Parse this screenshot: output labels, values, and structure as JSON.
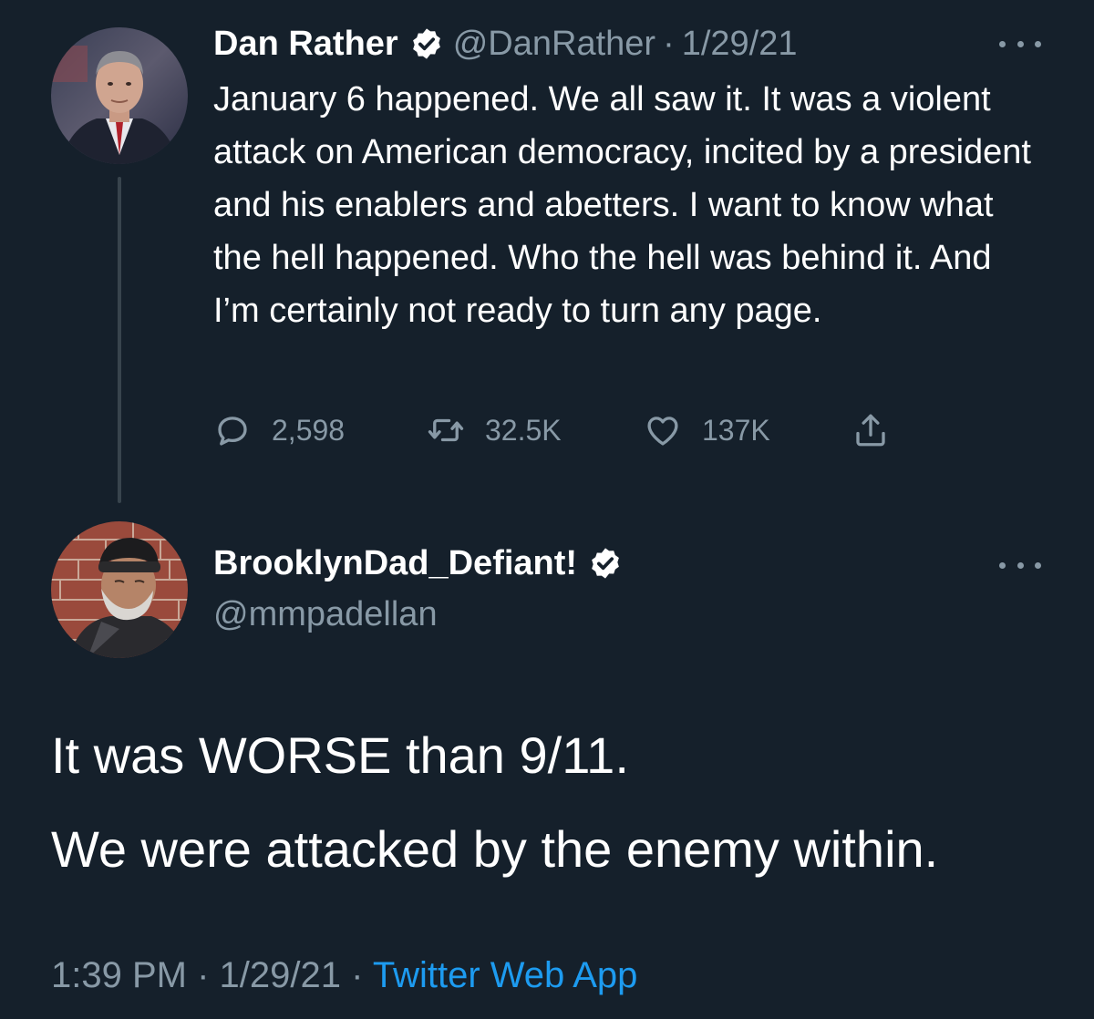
{
  "original_tweet": {
    "author_name": "Dan Rather",
    "handle": "@DanRather",
    "separator": "·",
    "date": "1/29/21",
    "text": "January 6 happened. We all saw it. It was a violent attack on American democracy, incited by a president and his enablers and abetters. I want to know what the hell happened. Who the hell was behind it. And I’m certainly not ready to turn any page.",
    "stats": {
      "replies": "2,598",
      "retweets": "32.5K",
      "likes": "137K"
    }
  },
  "reply_tweet": {
    "author_name": "BrooklynDad_Defiant!",
    "handle": "@mmpadellan",
    "lines": [
      "It was WORSE than 9/11.",
      "We were attacked by the enemy within."
    ],
    "footer": {
      "time": "1:39 PM",
      "date": "1/29/21",
      "separator": "·",
      "source": "Twitter Web App"
    }
  },
  "colors": {
    "background": "#15202b",
    "text": "#ffffff",
    "secondary": "#8899a6",
    "link": "#1d9bf0",
    "thread_line": "#38444d"
  },
  "icons": [
    "verified-badge-icon",
    "more-options-icon",
    "reply-icon",
    "retweet-icon",
    "like-icon",
    "share-icon"
  ]
}
